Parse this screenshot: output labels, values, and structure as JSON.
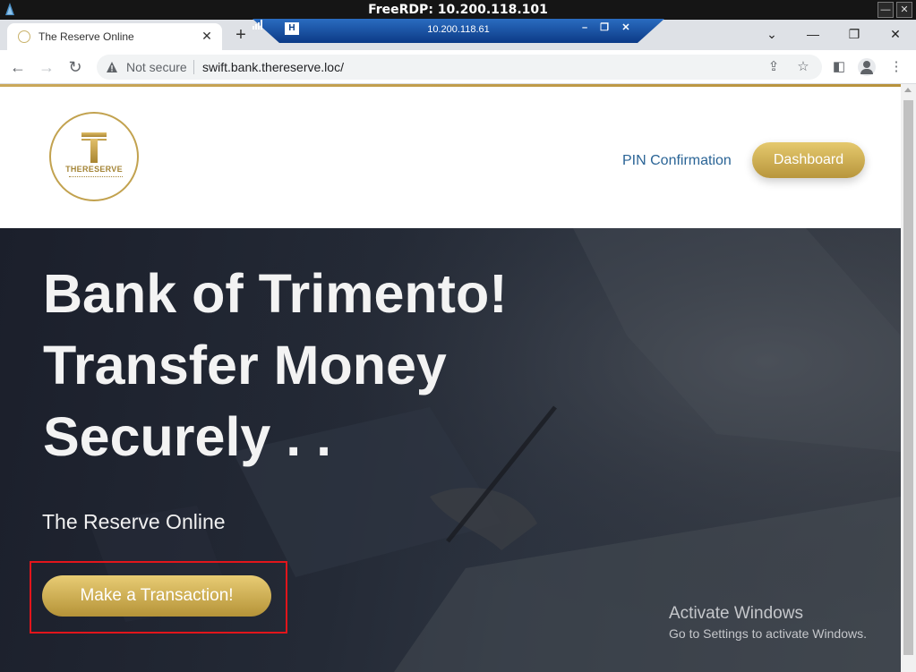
{
  "rdp": {
    "title": "FreeRDP: 10.200.118.101",
    "connection_bar_ip": "10.200.118.61",
    "pin_label": "H"
  },
  "browser": {
    "tab_title": "The Reserve Online",
    "tab_close": "✕",
    "new_tab": "+",
    "security_label": "Not secure",
    "url": "swift.bank.thereserve.loc/"
  },
  "site": {
    "logo_name": "THERESERVE",
    "nav_link": "PIN Confirmation",
    "dashboard_button": "Dashboard",
    "hero_lines": [
      "Bank of Trimento!",
      "Transfer Money",
      "Securely . ."
    ],
    "hero_subtitle": "The Reserve Online",
    "cta_button": "Make a Transaction!",
    "accent_color": "#c9a64d"
  },
  "watermark": {
    "title": "Activate Windows",
    "subtitle": "Go to Settings to activate Windows."
  }
}
